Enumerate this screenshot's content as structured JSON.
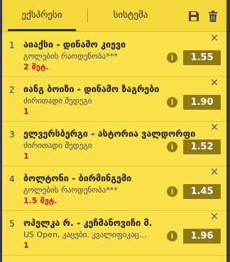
{
  "tabs": {
    "express": "ექსპრესი",
    "system": "სისტემა"
  },
  "bets": [
    {
      "num": "1",
      "title": "აიაქსი - დინამო კიევი",
      "market": "გოლების რაოდენობა***",
      "selection": "2 მეტ.",
      "odds": "1.55"
    },
    {
      "num": "2",
      "title": "იანგ ბოიზი - დინამო ზაგრები",
      "market": "ძირითადი შედეგი",
      "selection": "1",
      "odds": "1.90"
    },
    {
      "num": "3",
      "title": "ელვერსბერგი - ასტორია ვალდორფი",
      "market": "ძირითადი შედეგი",
      "selection": "1",
      "odds": "1.52"
    },
    {
      "num": "4",
      "title": "ბოლტონი - ბირმინგემი",
      "market": "გოლების რაოდენობა***",
      "selection": "1.5 მეტ.",
      "odds": "1.45"
    },
    {
      "num": "5",
      "title": "ოპელკა რ. - კეჩმანოვიჩი მ.",
      "market": "US Open, კაცები. კვალიფიკაც...",
      "selection": "1",
      "odds": "1.96"
    }
  ],
  "icons": {
    "close": "×",
    "info": "i"
  },
  "colors": {
    "panel": "#fbe14d",
    "odds_bg": "#8f7711",
    "selection": "#d1131a"
  }
}
